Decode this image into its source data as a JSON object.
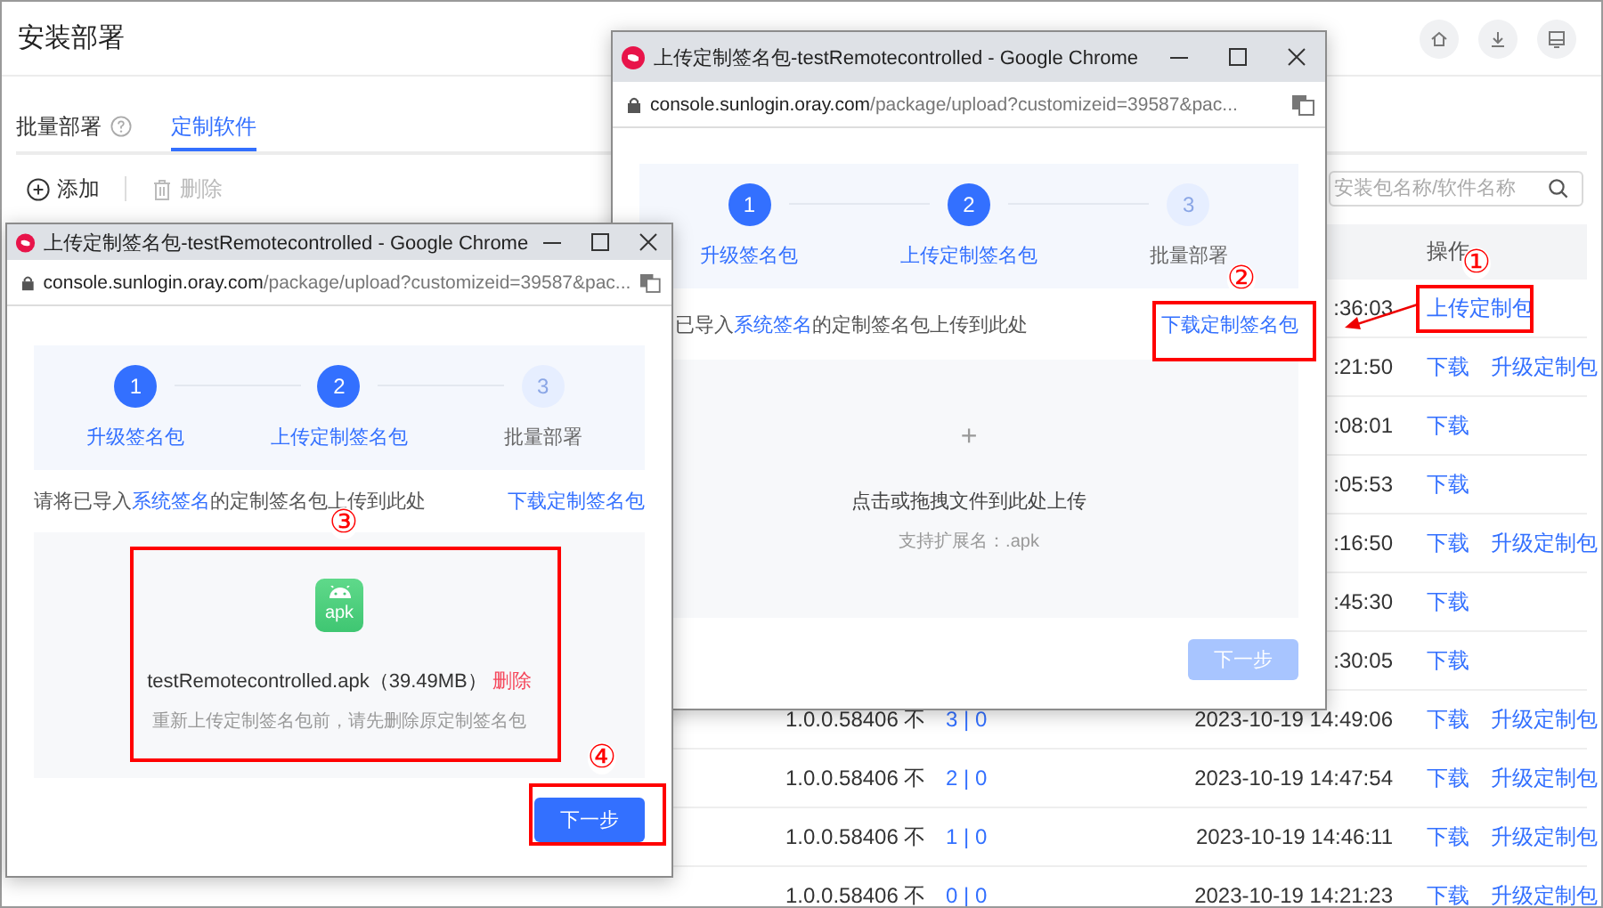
{
  "app": {
    "title": "安装部署",
    "tabs": [
      {
        "label": "批量部署",
        "selected": false,
        "help": true
      },
      {
        "label": "定制软件",
        "selected": true,
        "help": false
      }
    ],
    "toolbar": [
      {
        "kind": "add",
        "label": "添加",
        "disabled": false
      },
      {
        "kind": "delete",
        "label": "删除",
        "disabled": true
      }
    ],
    "search": {
      "placeholder": "安装包名称/软件名称"
    },
    "table": {
      "columns": [
        {
          "label": "操作"
        }
      ],
      "rows": [
        {
          "time": ":36:03",
          "actions": [
            "上传定制包"
          ]
        },
        {
          "time": ":21:50",
          "actions": [
            "下载",
            "升级定制包"
          ]
        },
        {
          "time": ":08:01",
          "actions": [
            "下载"
          ]
        },
        {
          "time": ":05:53",
          "actions": [
            "下载"
          ]
        },
        {
          "time": ":16:50",
          "actions": [
            "下载",
            "升级定制包"
          ]
        },
        {
          "time": ":45:30",
          "actions": [
            "下载"
          ]
        },
        {
          "time": ":30:05",
          "actions": [
            "下载"
          ]
        },
        {
          "version": "1.0.0.58406 不",
          "count": "3 | 0",
          "time": "2023-10-19 14:49:06",
          "actions": [
            "下载",
            "升级定制包"
          ]
        },
        {
          "version": "1.0.0.58406 不",
          "count": "2 | 0",
          "time": "2023-10-19 14:47:54",
          "actions": [
            "下载",
            "升级定制包"
          ]
        },
        {
          "version": "1.0.0.58406 不",
          "count": "1 | 0",
          "time": "2023-10-19 14:46:11",
          "actions": [
            "下载",
            "升级定制包"
          ]
        },
        {
          "version": "1.0.0.58406 不",
          "count": "0 | 0",
          "time": "2023-10-19 14:21:23",
          "actions": [
            "下载",
            "升级定制包"
          ]
        }
      ]
    }
  },
  "windows": [
    {
      "title": "上传定制签名包-testRemotecontrolled - Google Chrome",
      "url_host": "console.sunlogin.oray.com",
      "url_path": "/package/upload?customizeid=39587&pac...",
      "steps": [
        {
          "number": "1",
          "label": "升级签名包",
          "active": true
        },
        {
          "number": "2",
          "label": "上传定制签名包",
          "active": true
        },
        {
          "number": "3",
          "label": "批量部署",
          "active": false
        }
      ],
      "instruction": {
        "before": "已导入",
        "link": "系统签名",
        "after": "的定制签名包上传到此处"
      },
      "download_link": "下载定制签名包",
      "upload": {
        "kind": "empty",
        "plus": "+",
        "prompt": "点击或拖拽文件到此处上传",
        "hint": "支持扩展名：.apk"
      },
      "next_button": {
        "label": "下一步",
        "disabled": true
      }
    },
    {
      "title": "上传定制签名包-testRemotecontrolled - Google Chrome",
      "url_host": "console.sunlogin.oray.com",
      "url_path": "/package/upload?customizeid=39587&pac...",
      "steps": [
        {
          "number": "1",
          "label": "升级签名包",
          "active": true
        },
        {
          "number": "2",
          "label": "上传定制签名包",
          "active": true
        },
        {
          "number": "3",
          "label": "批量部署",
          "active": false
        }
      ],
      "instruction": {
        "before": "请将已导入",
        "link": "系统签名",
        "after": "的定制签名包上传到此处"
      },
      "download_link": "下载定制签名包",
      "upload": {
        "kind": "file",
        "icon_label": "apk",
        "file_name": "testRemotecontrolled.apk（39.49MB）",
        "delete": "删除",
        "hint": "重新上传定制签名包前，请先删除原定制签名包"
      },
      "next_button": {
        "label": "下一步",
        "disabled": false
      }
    }
  ],
  "callouts": [
    {
      "label": "①",
      "arrow": true
    },
    {
      "label": "②",
      "arrow": false
    },
    {
      "label": "③",
      "arrow": false
    },
    {
      "label": "④",
      "arrow": false
    }
  ]
}
